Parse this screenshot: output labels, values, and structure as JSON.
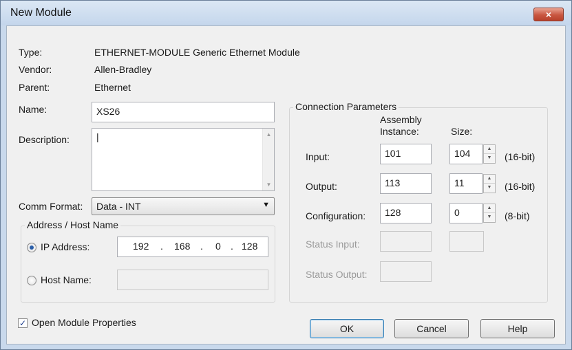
{
  "window": {
    "title": "New Module",
    "close_icon": "×"
  },
  "info": {
    "type_label": "Type:",
    "type_value": "ETHERNET-MODULE Generic Ethernet Module",
    "vendor_label": "Vendor:",
    "vendor_value": "Allen-Bradley",
    "parent_label": "Parent:",
    "parent_value": "Ethernet"
  },
  "name": {
    "label": "Name:",
    "value": "XS26"
  },
  "description": {
    "label": "Description:",
    "value": "|"
  },
  "comm_format": {
    "label": "Comm Format:",
    "value": "Data - INT"
  },
  "address": {
    "group_label": "Address / Host Name",
    "ip_label": "IP Address:",
    "ip_octets": [
      "192",
      "168",
      "0",
      "128"
    ],
    "ip_selected": true,
    "host_label": "Host Name:",
    "host_value": ""
  },
  "connection": {
    "group_label": "Connection Parameters",
    "assembly_header_line1": "Assembly",
    "assembly_header_line2": "Instance:",
    "size_header": "Size:",
    "rows": [
      {
        "label": "Input:",
        "instance": "101",
        "size": "104",
        "unit": "(16-bit)"
      },
      {
        "label": "Output:",
        "instance": "113",
        "size": "11",
        "unit": "(16-bit)"
      },
      {
        "label": "Configuration:",
        "instance": "128",
        "size": "0",
        "unit": "(8-bit)"
      }
    ],
    "status_input_label": "Status Input:",
    "status_output_label": "Status Output:"
  },
  "footer": {
    "open_props_label": "Open Module Properties",
    "open_props_checked": true,
    "ok_label": "OK",
    "cancel_label": "Cancel",
    "help_label": "Help"
  }
}
